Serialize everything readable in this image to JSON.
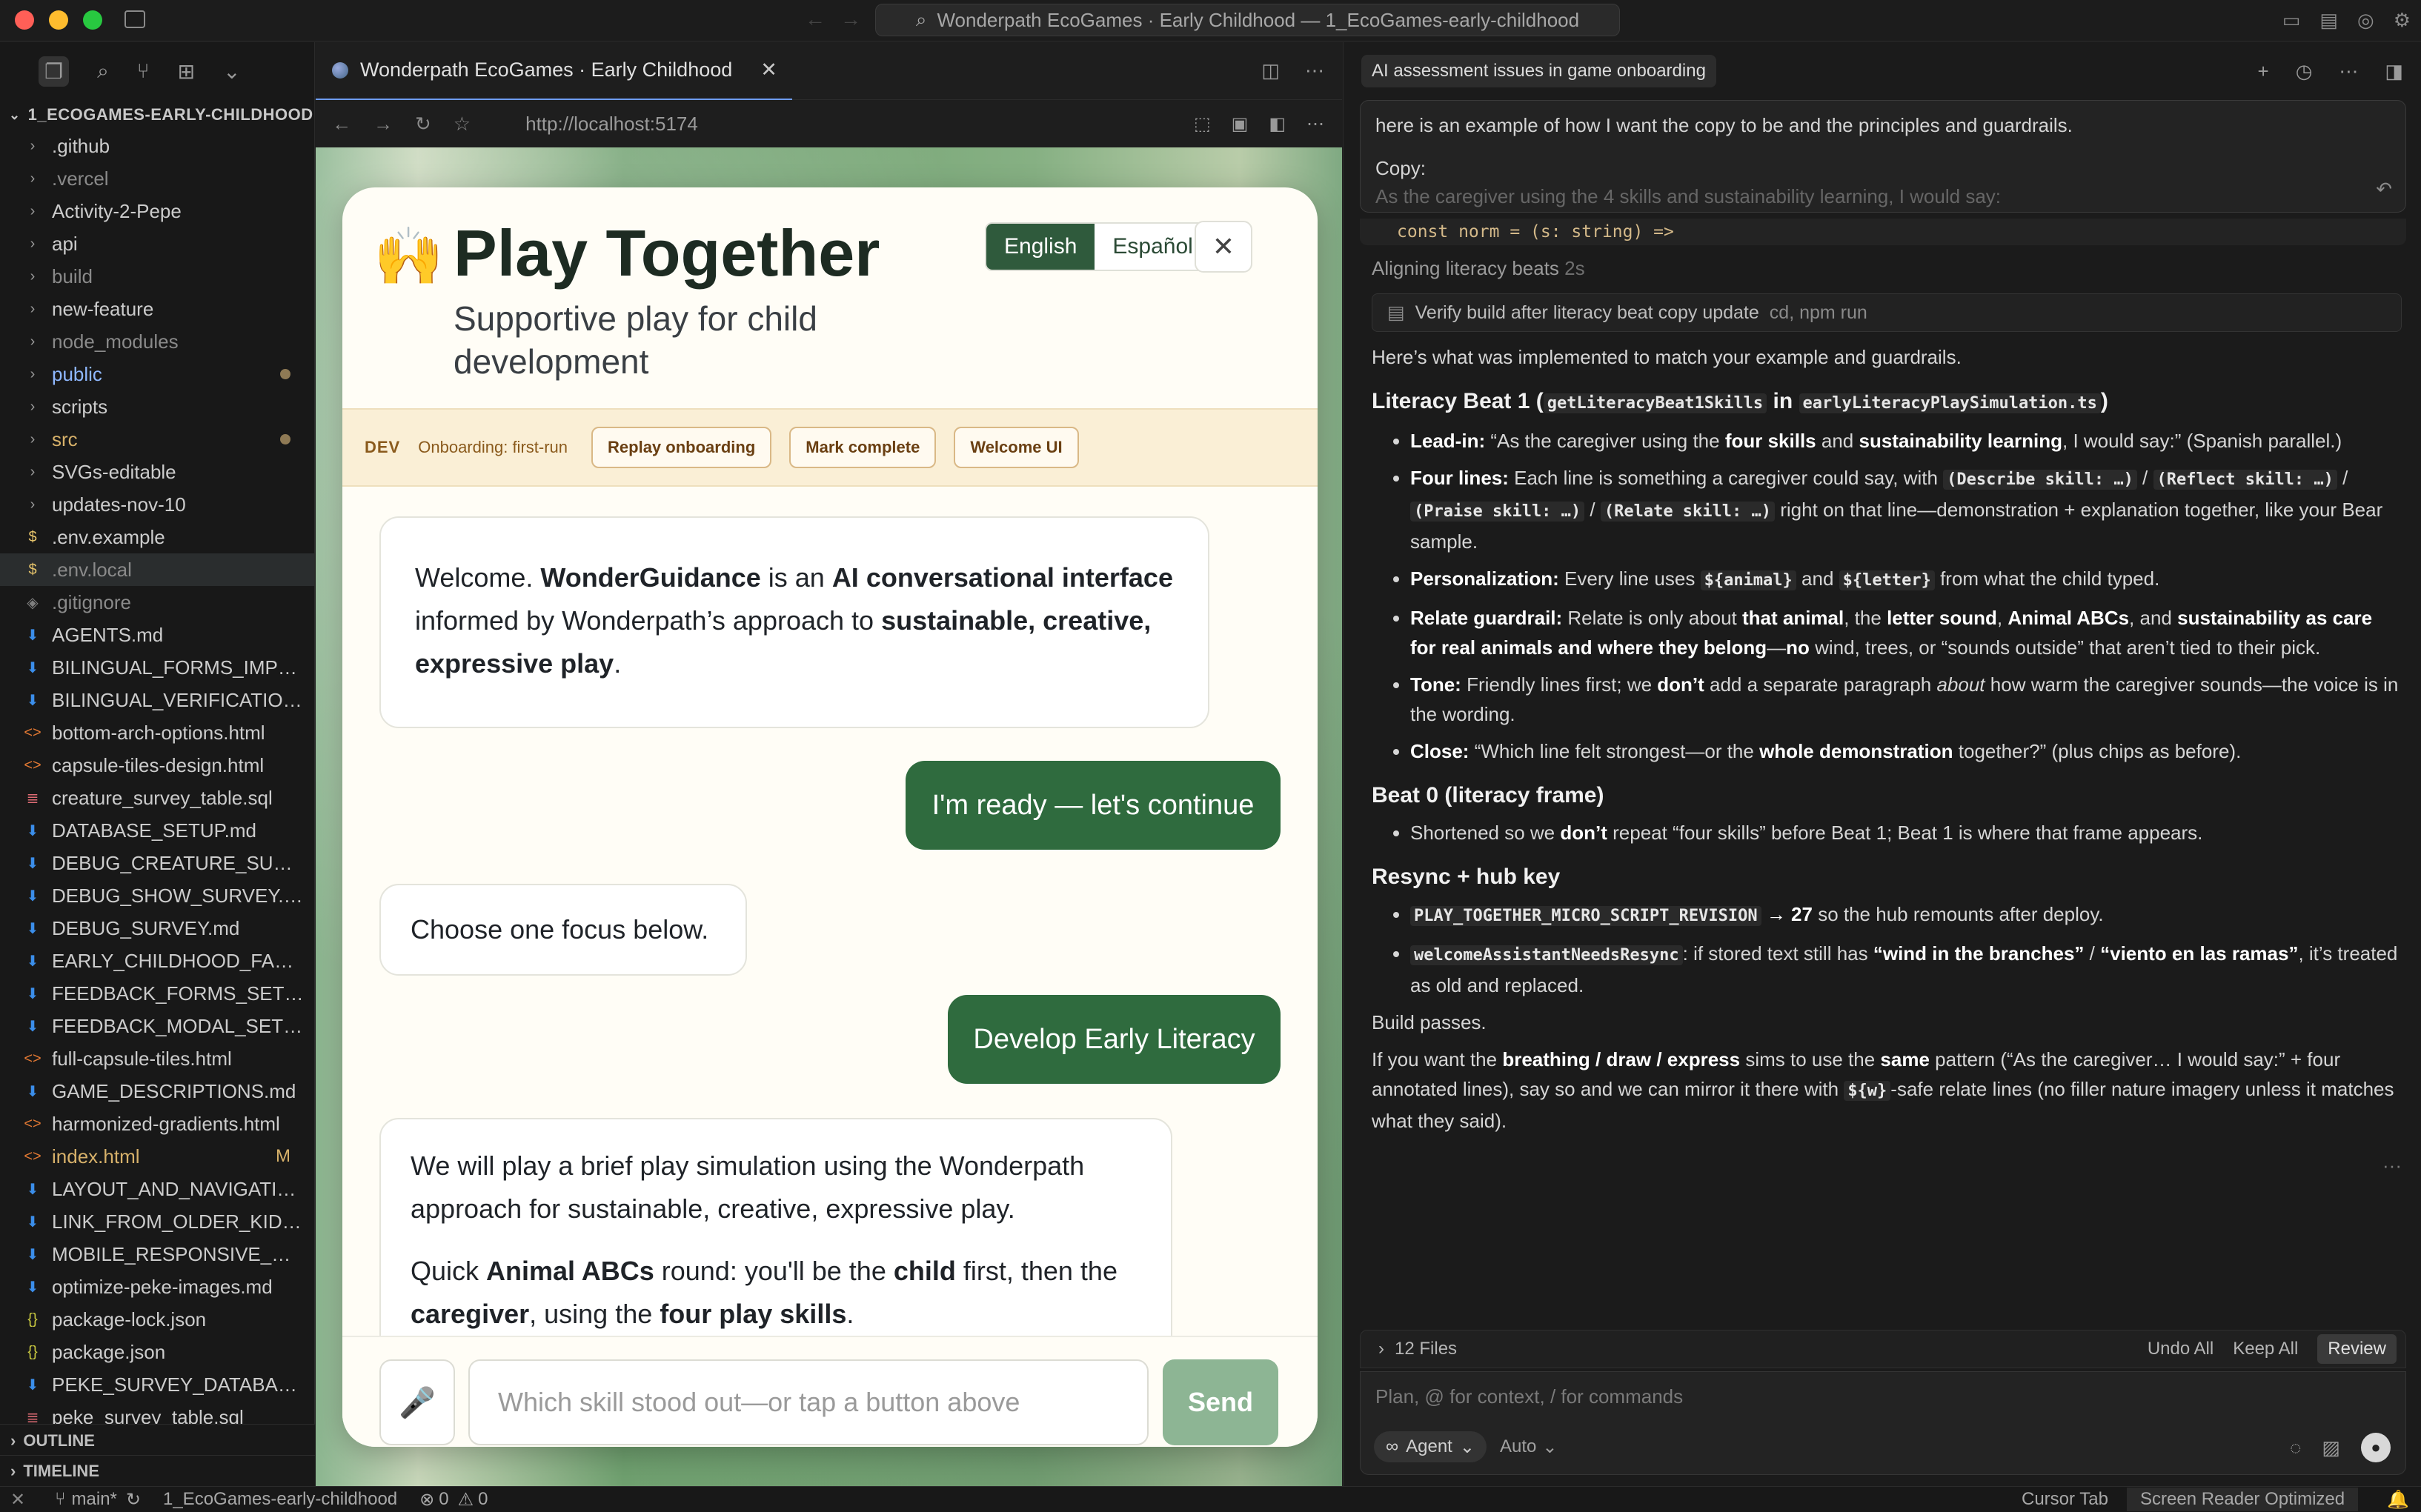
{
  "titlebar": {
    "command_center": "Wonderpath EcoGames · Early Childhood — 1_EcoGames-early-childhood"
  },
  "sidebar": {
    "root_label": "1_ECOGAMES-EARLY-CHILDHOOD",
    "items": [
      {
        "name": ".github",
        "type": "folder"
      },
      {
        "name": ".vercel",
        "type": "folder",
        "dim": true
      },
      {
        "name": "Activity-2-Pepe",
        "type": "folder"
      },
      {
        "name": "api",
        "type": "folder"
      },
      {
        "name": "build",
        "type": "folder",
        "dim": true
      },
      {
        "name": "new-feature",
        "type": "folder"
      },
      {
        "name": "node_modules",
        "type": "folder",
        "dim": true
      },
      {
        "name": "public",
        "type": "folder",
        "modified": true
      },
      {
        "name": "scripts",
        "type": "folder"
      },
      {
        "name": "src",
        "type": "folder",
        "modified": true
      },
      {
        "name": "SVGs-editable",
        "type": "folder"
      },
      {
        "name": "updates-nov-10",
        "type": "folder"
      },
      {
        "name": ".env.example",
        "type": "env"
      },
      {
        "name": ".env.local",
        "type": "env",
        "dim": true,
        "selected": true
      },
      {
        "name": ".gitignore",
        "type": "git",
        "dim": true
      },
      {
        "name": "AGENTS.md",
        "type": "md"
      },
      {
        "name": "BILINGUAL_FORMS_IMPLE...",
        "type": "md"
      },
      {
        "name": "BILINGUAL_VERIFICATION....",
        "type": "md"
      },
      {
        "name": "bottom-arch-options.html",
        "type": "html"
      },
      {
        "name": "capsule-tiles-design.html",
        "type": "html"
      },
      {
        "name": "creature_survey_table.sql",
        "type": "sql"
      },
      {
        "name": "DATABASE_SETUP.md",
        "type": "md"
      },
      {
        "name": "DEBUG_CREATURE_SURVE...",
        "type": "md"
      },
      {
        "name": "DEBUG_SHOW_SURVEY.md",
        "type": "md"
      },
      {
        "name": "DEBUG_SURVEY.md",
        "type": "md"
      },
      {
        "name": "EARLY_CHILDHOOD_FAQ.md",
        "type": "md"
      },
      {
        "name": "FEEDBACK_FORMS_SETUP....",
        "type": "md"
      },
      {
        "name": "FEEDBACK_MODAL_SETUP...",
        "type": "md"
      },
      {
        "name": "full-capsule-tiles.html",
        "type": "html"
      },
      {
        "name": "GAME_DESCRIPTIONS.md",
        "type": "md"
      },
      {
        "name": "harmonized-gradients.html",
        "type": "html"
      },
      {
        "name": "index.html",
        "type": "html",
        "marker": "M"
      },
      {
        "name": "LAYOUT_AND_NAVIGATIO...",
        "type": "md"
      },
      {
        "name": "LINK_FROM_OLDER_KIDS_...",
        "type": "md"
      },
      {
        "name": "MOBILE_RESPONSIVE_DES...",
        "type": "md"
      },
      {
        "name": "optimize-peke-images.md",
        "type": "md"
      },
      {
        "name": "package-lock.json",
        "type": "json"
      },
      {
        "name": "package.json",
        "type": "json"
      },
      {
        "name": "PEKE_SURVEY_DATABASE_...",
        "type": "md"
      },
      {
        "name": "peke_survey_table.sql",
        "type": "sql"
      }
    ],
    "outline_label": "OUTLINE",
    "timeline_label": "TIMELINE"
  },
  "statusbar": {
    "branch": "main*",
    "workspace": "1_EcoGames-early-childhood",
    "problems": "0",
    "warnings": "0",
    "cursor_tab": "Cursor Tab",
    "screen_reader": "Screen Reader Optimized"
  },
  "browser": {
    "tab_title": "Wonderpath EcoGames · Early Childhood",
    "url": "http://localhost:5174"
  },
  "modal": {
    "emoji": "🙌",
    "title": "Play Together",
    "subtitle": "Supportive play for child development",
    "lang_en": "English",
    "lang_es": "Español",
    "dev_tag": "DEV",
    "dev_status": "Onboarding: first-run",
    "dev_buttons": [
      "Replay onboarding",
      "Mark complete",
      "Welcome UI"
    ],
    "welcome": {
      "p1": "Welcome. ",
      "b1": "WonderGuidance",
      "p2": " is an ",
      "b2": "AI conversational interface",
      "p3": " informed by Wonderpath’s approach to ",
      "b3": "sustainable, creative, expressive play",
      "p4": "."
    },
    "user_msg_1": "I'm ready — let's continue",
    "choose_msg": "Choose one focus below.",
    "user_msg_2": "Develop Early Literacy",
    "sim_msg": {
      "line1": "We will play a brief play simulation using the Wonderpath approach for sustainable, creative, expressive play.",
      "q1": "Quick ",
      "qb1": "Animal ABCs",
      "q2": " round: you'll be the ",
      "qb2": "child",
      "q3": " first, then the ",
      "qb3": "caregiver",
      "q4": ", using the ",
      "qb4": "four play skills",
      "q5": "."
    },
    "input_placeholder": "Which skill stood out—or tap a button above",
    "send_label": "Send"
  },
  "assistant": {
    "title": "AI assessment issues in game onboarding",
    "prompt_line1": "here is an example of how I want the copy to be and the principles and guardrails.",
    "prompt_line2": "Copy:",
    "prompt_line3": "As the caregiver using the 4 skills and sustainability learning, I would say:",
    "code_line": "const norm = (s: string) =>",
    "thinking": "Aligning literacy beats",
    "thinking_time": "2s",
    "tool_label": "Verify build after literacy beat copy update",
    "tool_sub": "cd, npm run",
    "intro": "Here’s what was implemented to match your example and guardrails.",
    "h_beat1_a": "Literacy Beat 1 (",
    "h_beat1_code1": "getLiteracyBeat1Skills",
    "h_beat1_in": "in",
    "h_beat1_code2": "earlyLiteracyPlaySimulation.ts",
    "h_beat1_b": ")",
    "leadin_label": "Lead-in:",
    "leadin_a": " “As the caregiver using the ",
    "leadin_b1": "four skills",
    "leadin_c": " and ",
    "leadin_b2": "sustainability learning",
    "leadin_d": ", I would say:” (Spanish parallel.)",
    "four_label": "Four lines:",
    "four_a": " Each line is something a caregiver could say, with ",
    "four_c1": "(Describe skill: …)",
    "four_c2": "(Reflect skill: …)",
    "four_c3": "(Praise skill: …)",
    "four_c4": "(Relate skill: …)",
    "four_b": " right on that line—demonstration + explanation together, like your Bear sample.",
    "pers_label": "Personalization:",
    "pers_a": " Every line uses ",
    "pers_c1": "${animal}",
    "pers_and": " and ",
    "pers_c2": "${letter}",
    "pers_b": " from what the child typed.",
    "rel_label": "Relate guardrail:",
    "rel_a": " Relate is only about ",
    "rel_b1": "that animal",
    "rel_c": ", the ",
    "rel_b2": "letter sound",
    "rel_d": ", ",
    "rel_b3": "Animal ABCs",
    "rel_e": ", and ",
    "rel_b4": "sustainability as care for real animals and where they belong",
    "rel_f": "—",
    "rel_b5": "no",
    "rel_g": " wind, trees, or “sounds outside” that aren’t tied to their pick.",
    "tone_label": "Tone:",
    "tone_a": " Friendly lines first; we ",
    "tone_b": "don’t",
    "tone_c": " add a separate paragraph ",
    "tone_i": "about",
    "tone_d": " how warm the caregiver sounds—the voice is in the wording.",
    "close_label": "Close:",
    "close_a": " “Which line felt strongest—or the ",
    "close_b": "whole demonstration",
    "close_c": " together?” (plus chips as before).",
    "h_beat0": "Beat 0 (literacy frame)",
    "beat0_a": "Shortened so we ",
    "beat0_b": "don’t",
    "beat0_c": " repeat “four skills” before Beat 1; Beat 1 is where that frame appears.",
    "h_resync": "Resync + hub key",
    "rs1_code": "PLAY_TOGETHER_MICRO_SCRIPT_REVISION",
    "rs1_a": " → ",
    "rs1_b": "27",
    "rs1_c": " so the hub remounts after deploy.",
    "rs2_code": "welcomeAssistantNeedsResync",
    "rs2_a": ": if stored text still has ",
    "rs2_b1": "“wind in the branches”",
    "rs2_c": " / ",
    "rs2_b2": "“viento en las ramas”",
    "rs2_d": ", it’s treated as old and replaced.",
    "build": "Build passes.",
    "final_a": "If you want the ",
    "final_b1": "breathing / draw / express",
    "final_c": " sims to use the ",
    "final_b2": "same",
    "final_d": " pattern (“As the caregiver… I would say:” + four annotated lines), say so and we can mirror it there with ",
    "final_code": "${w}",
    "final_e": "-safe relate lines (no filler nature imagery unless it matches what they said).",
    "more": "···",
    "files_count": "12 Files",
    "undo_all": "Undo All",
    "keep_all": "Keep All",
    "review": "Review",
    "composer_placeholder": "Plan, @ for context, / for commands",
    "mode": "Agent",
    "model": "Auto"
  }
}
